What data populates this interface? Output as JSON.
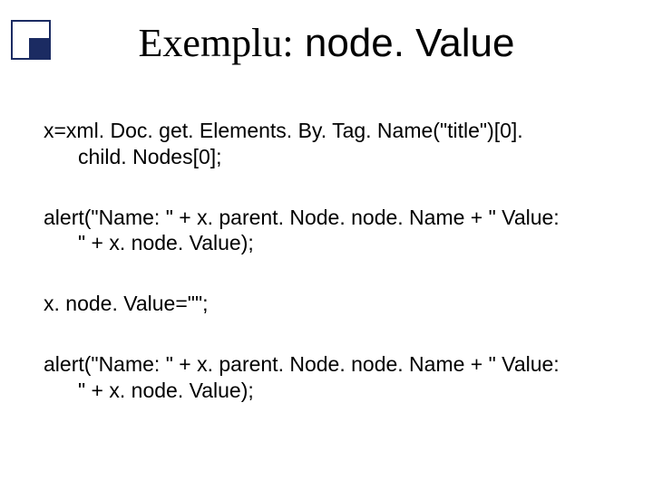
{
  "title": {
    "prefix": "Exemplu:",
    "keyword": " node. Value"
  },
  "code": {
    "p1_l1": "x=xml. Doc. get. Elements. By. Tag. Name(\"title\")[0].",
    "p1_l2": "child. Nodes[0];",
    "p2_l1": "alert(\"Name: \" + x. parent. Node. node. Name + \"  Value:",
    "p2_l2": "\" + x. node. Value);",
    "p3_l1": "x. node. Value=\"\";",
    "p4_l1": "alert(\"Name: \" + x. parent. Node. node. Name + \"  Value:",
    "p4_l2": "\" + x. node. Value);"
  }
}
